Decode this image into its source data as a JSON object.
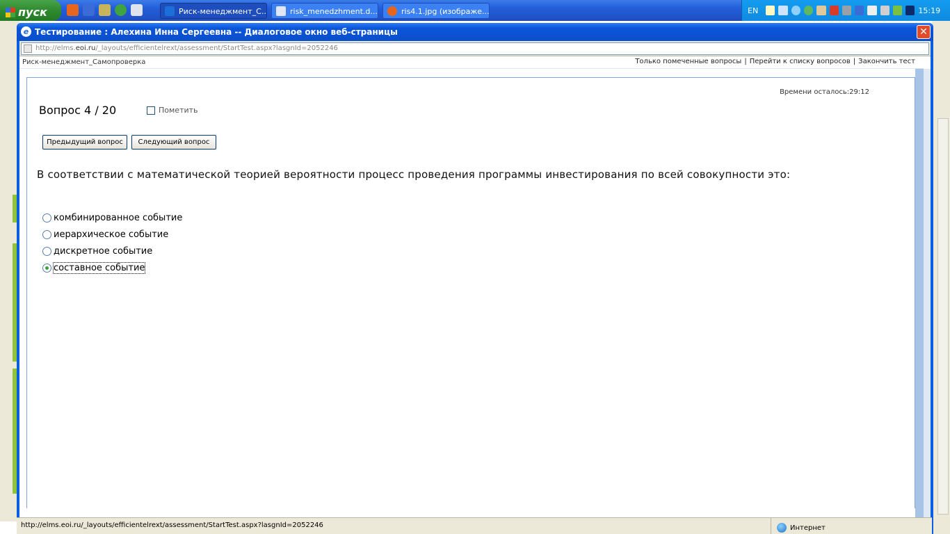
{
  "taskbar": {
    "start_label": "пуск",
    "tasks": [
      {
        "label": "Риск-менеджмент_С..."
      },
      {
        "label": "risk_menedzhment.d..."
      },
      {
        "label": "ris4.1.jpg (изображе..."
      }
    ],
    "lang": "EN",
    "clock": "15:19"
  },
  "dialog": {
    "title": "Тестирование : Алехина Инна Сергеевна -- Диалоговое окно веб-страницы",
    "close_label": "✕",
    "address_prefix": "http://elms.",
    "address_domain": "eoi.ru",
    "address_rest": "/_layouts/efficientelrext/assessment/StartTest.aspx?lasgnId=2052246"
  },
  "page": {
    "breadcrumb": "Риск-менеджмент_Самопроверка",
    "links": {
      "marked": "Только помеченные вопросы",
      "sep1": "|",
      "list": "Перейти к списку вопросов",
      "sep2": "|",
      "finish": "Закончить тест"
    },
    "timer": "Времени осталось:29:12",
    "question_number": "Вопрос 4 / 20",
    "mark_label": "Пометить",
    "prev_button": "Предыдущий вопрос",
    "next_button": "Следующий вопрос",
    "question_text": "В соответствии с математической теорией вероятности процесс проведения программы инвестирования по всей совокупности это:",
    "answers": [
      {
        "label": "комбинированное событие",
        "selected": false
      },
      {
        "label": "иерархическое событие",
        "selected": false
      },
      {
        "label": "дискретное событие",
        "selected": false
      },
      {
        "label": "составное событие",
        "selected": true
      }
    ]
  },
  "statusbar": {
    "url": "http://elms.eoi.ru/_layouts/efficientelrext/assessment/StartTest.aspx?lasgnId=2052246",
    "zone": "Интернет"
  },
  "colors": {
    "titlebar": "#0a55d8",
    "frame_border": "#7fa6d8",
    "selected_radio": "#3aa33a"
  }
}
